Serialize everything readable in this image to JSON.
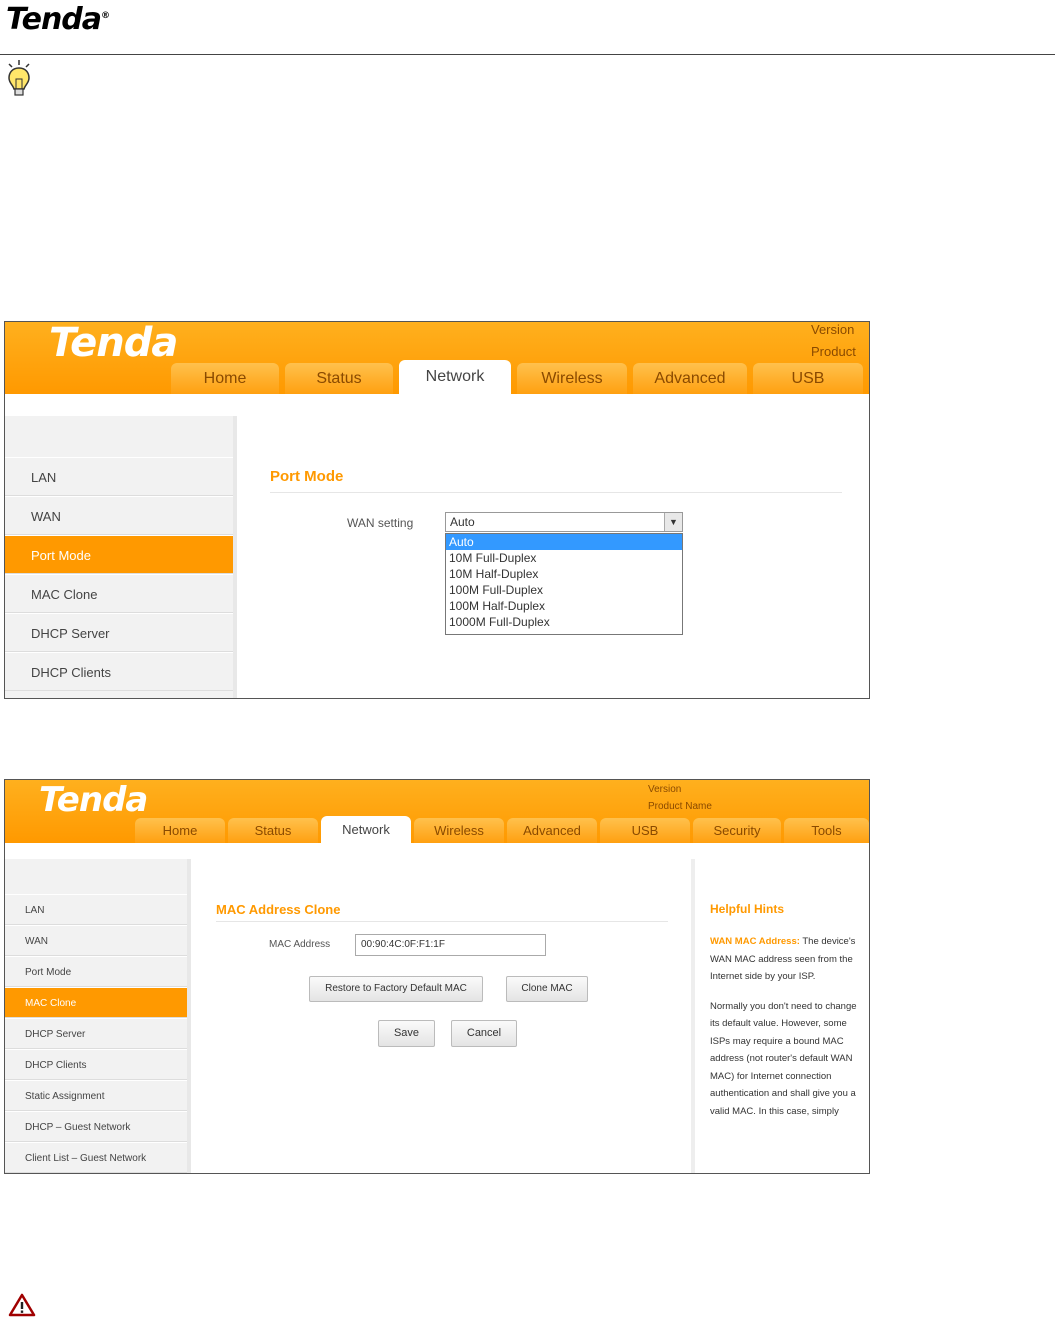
{
  "doc": {
    "logo": "Tenda",
    "reg": "®"
  },
  "s1": {
    "logo": "Tenda",
    "info": [
      "Version",
      "Product"
    ],
    "tabs": [
      "Home",
      "Status",
      "Network",
      "Wireless",
      "Advanced",
      "USB"
    ],
    "sidebar": [
      "LAN",
      "WAN",
      "Port Mode",
      "MAC Clone",
      "DHCP Server",
      "DHCP Clients"
    ],
    "section_title": "Port Mode",
    "wan_label": "WAN setting",
    "wan_value": "Auto",
    "options": [
      "Auto",
      "10M Full-Duplex",
      "10M Half-Duplex",
      "100M Full-Duplex",
      "100M Half-Duplex",
      "1000M Full-Duplex"
    ]
  },
  "s2": {
    "logo": "Tenda",
    "info": {
      "version_label": "Version",
      "product_label": "Product Name"
    },
    "tabs": [
      "Home",
      "Status",
      "Network",
      "Wireless",
      "Advanced",
      "USB",
      "Security",
      "Tools"
    ],
    "sidebar": [
      "LAN",
      "WAN",
      "Port Mode",
      "MAC Clone",
      "DHCP Server",
      "DHCP Clients",
      "Static Assignment",
      "DHCP – Guest Network",
      "Client List – Guest Network"
    ],
    "section_title": "MAC Address Clone",
    "mac_label": "MAC Address",
    "mac_value": "00:90:4C:0F:F1:1F",
    "restore_btn": "Restore to Factory Default MAC",
    "clone_btn": "Clone MAC",
    "save_btn": "Save",
    "cancel_btn": "Cancel",
    "hints_title": "Helpful Hints",
    "hints_term": "WAN MAC Address:",
    "hints_p1": " The device's WAN MAC address seen from the Internet side by your ISP.",
    "hints_p2": "Normally you don't need to change its default value. However, some ISPs may require a bound MAC address (not router's default WAN MAC) for Internet connection authentication and shall give you a valid MAC. In this case, simply"
  },
  "colors": {
    "accent": "#ff9900",
    "warning": "#a00000"
  }
}
